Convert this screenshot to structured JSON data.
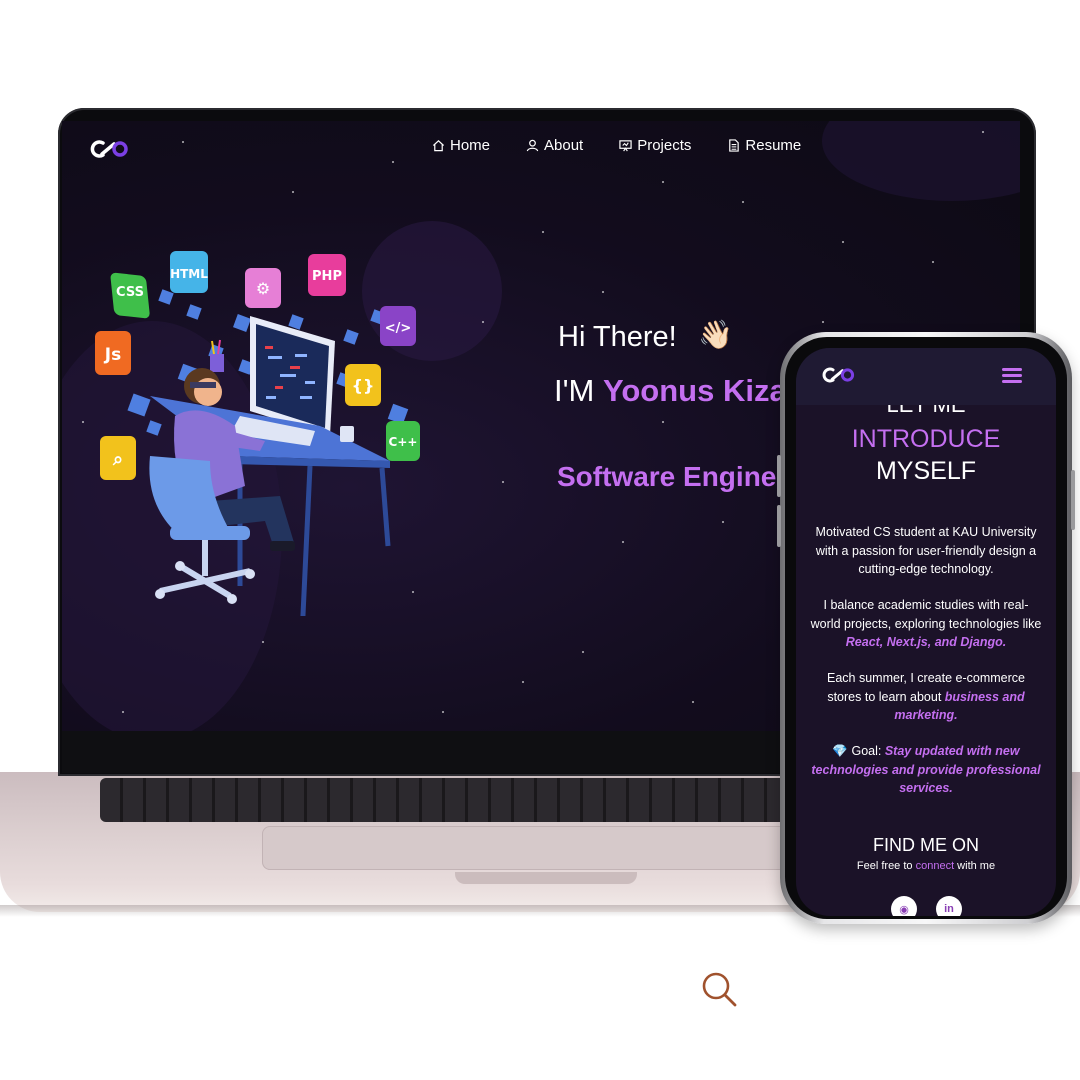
{
  "laptop": {
    "nav": [
      {
        "label": "Home",
        "icon": "home-icon"
      },
      {
        "label": "About",
        "icon": "user-icon"
      },
      {
        "label": "Projects",
        "icon": "presentation-icon"
      },
      {
        "label": "Resume",
        "icon": "document-icon"
      }
    ],
    "hero": {
      "greeting": "Hi There!",
      "wave": "👋🏻",
      "im_prefix": "I'M ",
      "name": "Yoonus Kiza",
      "role": "Software Enginee"
    }
  },
  "phone": {
    "title_line1": "LET ME",
    "title_line2": "INTRODUCE",
    "title_line3": "MYSELF",
    "p1": "Motivated CS student at KAU University with a passion for user-friendly design a cutting-edge technology.",
    "p2_text": "I balance academic studies with real-world projects, exploring technologies like ",
    "p2_em": "React, Next.js, and Django.",
    "p3_text": "Each summer, I create e-commerce stores to learn about ",
    "p3_em": "business and marketing.",
    "p4_icon": "💎",
    "p4_label": " Goal: ",
    "p4_em": "Stay updated with new technologies and provide professional services.",
    "find_title": "FIND ME ON",
    "find_sub_before": "Feel free to ",
    "find_sub_link": "connect",
    "find_sub_after": " with me"
  },
  "colors": {
    "accent": "#c46ff0",
    "background": "#120c1d"
  }
}
